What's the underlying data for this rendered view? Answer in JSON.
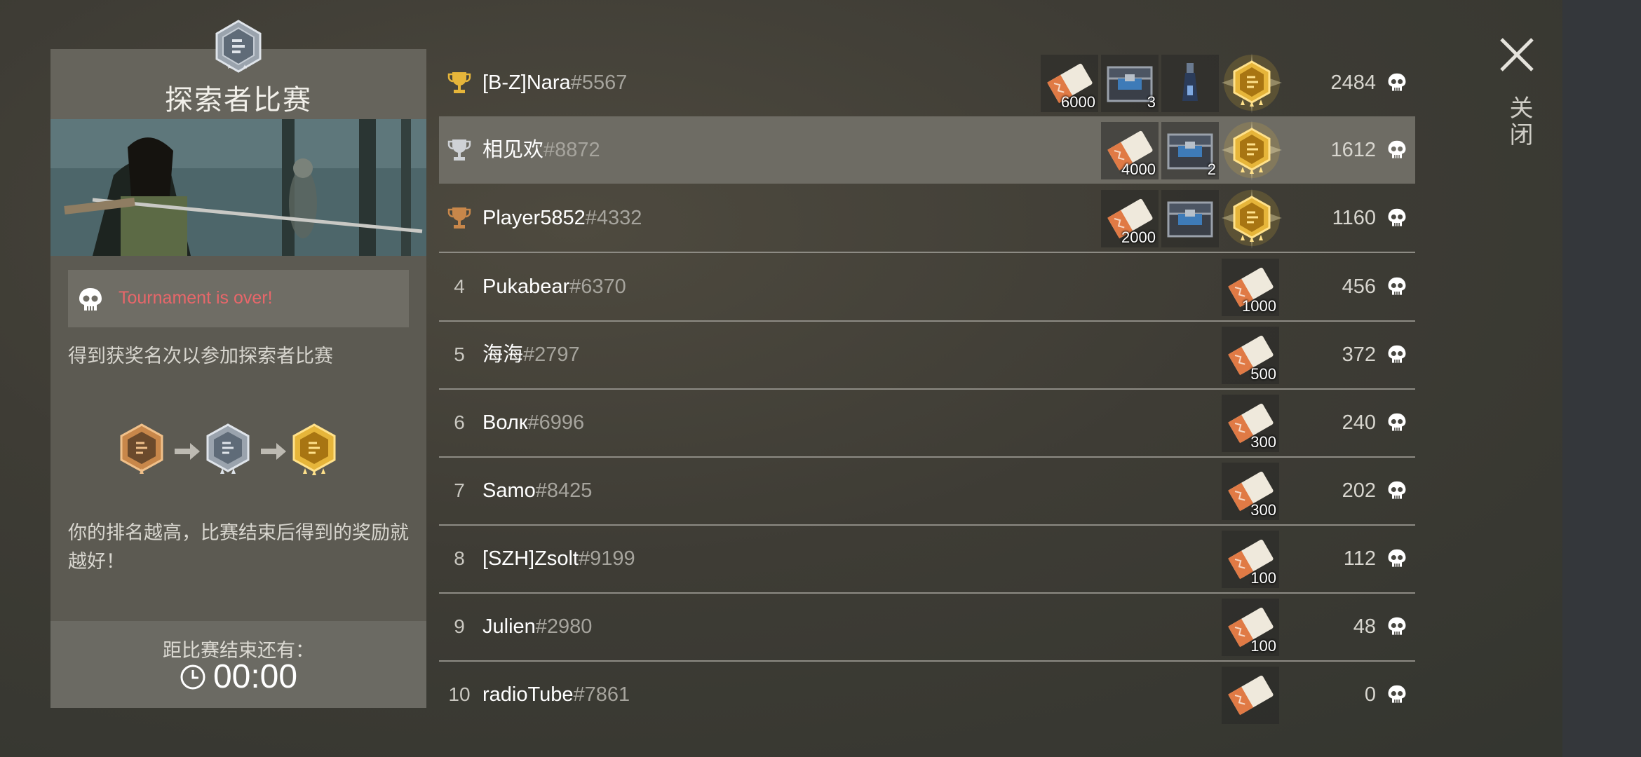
{
  "panel": {
    "title": "探索者比赛",
    "status_text": "Tournament is over!",
    "description": "得到获奖名次以参加探索者比赛",
    "hint": "你的排名越高，比赛结束后得到的奖励就越好！",
    "time_left_label": "距比赛结束还有：",
    "time_left_value": "00:00"
  },
  "close_label": "关闭",
  "colors": {
    "status_red": "#e8676a",
    "gold": "#e6b53a",
    "silver": "#cfd2d6",
    "bronze": "#c8874a",
    "highlight_row": "#6e6c64"
  },
  "leaderboard": [
    {
      "rank": "",
      "trophy": "gold",
      "name": "[B-Z]Nara",
      "tag": "#5567",
      "tickets": "6000",
      "chests": "3",
      "extra_item": "potion",
      "medal": "gold",
      "score": "2484"
    },
    {
      "rank": "",
      "trophy": "silver",
      "name": "相见欢",
      "tag": "#8872",
      "tickets": "4000",
      "chests": "2",
      "medal": "gold",
      "score": "1612",
      "highlighted": true
    },
    {
      "rank": "",
      "trophy": "bronze",
      "name": "Player5852",
      "tag": "#4332",
      "tickets": "2000",
      "chests": "",
      "medal": "gold",
      "score": "1160"
    },
    {
      "rank": "4",
      "name": "Pukabear",
      "tag": "#6370",
      "tickets": "1000",
      "score": "456"
    },
    {
      "rank": "5",
      "name": "海海",
      "tag": "#2797",
      "tickets": "500",
      "score": "372"
    },
    {
      "rank": "6",
      "name": "Волк",
      "tag": "#6996",
      "tickets": "300",
      "score": "240"
    },
    {
      "rank": "7",
      "name": "Samo",
      "tag": "#8425",
      "tickets": "300",
      "score": "202"
    },
    {
      "rank": "8",
      "name": "[SZH]Zsolt",
      "tag": "#9199",
      "tickets": "100",
      "score": "112"
    },
    {
      "rank": "9",
      "name": "Julien",
      "tag": "#2980",
      "tickets": "100",
      "score": "48"
    },
    {
      "rank": "10",
      "name": "radioTube",
      "tag": "#7861",
      "tickets": "",
      "score": "0"
    }
  ]
}
